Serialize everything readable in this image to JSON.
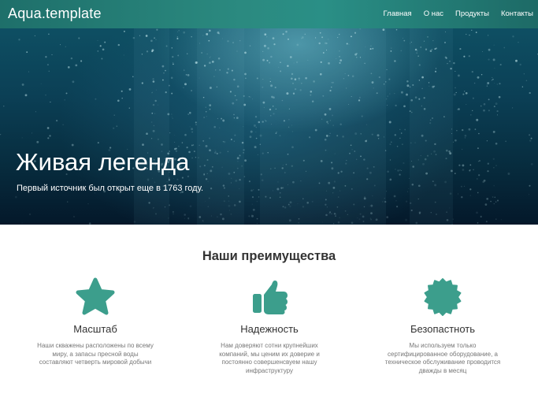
{
  "header": {
    "brand": "Aqua.template",
    "nav": [
      "Главная",
      "О нас",
      "Продукты",
      "Контакты"
    ]
  },
  "hero": {
    "title": "Живая легенда",
    "subtitle": "Первый источник был открыт еще в 1763 году."
  },
  "advantages": {
    "title": "Наши преимущества",
    "items": [
      {
        "icon": "star-icon",
        "title": "Масштаб",
        "text": "Наши скважены расположены по всему миру, а запасы пресной воды составляют четверть мировой добычи"
      },
      {
        "icon": "thumbs-up-icon",
        "title": "Надежность",
        "text": "Нам доверяют сотни крупнейших компаний, мы ценим их доверие и постоянно совершенсвуем нашу инфраструктуру"
      },
      {
        "icon": "certificate-icon",
        "title": "Безопастноть",
        "text": "Мы используем только сертифицированное оборудование, а техническое обслуживание проводится дважды в месяц"
      }
    ]
  },
  "colors": {
    "accent": "#3c9e8c",
    "header_gradient_start": "#1e6f6a",
    "header_gradient_end": "#2a8f86",
    "hero_deep": "#04182a"
  }
}
